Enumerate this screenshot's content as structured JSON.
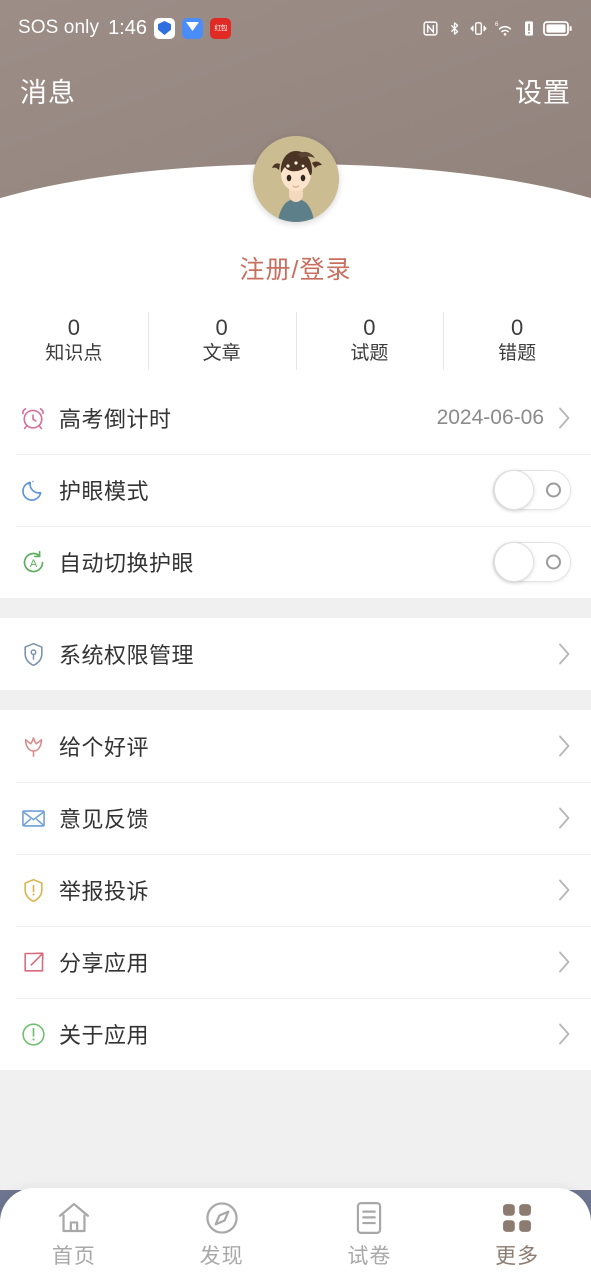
{
  "statusbar": {
    "carrier": "SOS only",
    "time": "1:46",
    "app_icons": [
      "shield-app-icon",
      "messenger-app-icon",
      "red-app-icon"
    ],
    "red_icon_text": "红包",
    "right_icons": [
      "nfc-icon",
      "bluetooth-icon",
      "vibrate-icon",
      "wifi6-icon",
      "signal-alert-icon",
      "battery-icon"
    ]
  },
  "header": {
    "left_title": "消息",
    "right_title": "设置",
    "background_color": "#968881"
  },
  "profile": {
    "avatar_name": "user-avatar",
    "login_text": "注册/登录",
    "login_color": "#c8705f"
  },
  "stats": [
    {
      "value": "0",
      "label": "知识点"
    },
    {
      "value": "0",
      "label": "文章"
    },
    {
      "value": "0",
      "label": "试题"
    },
    {
      "value": "0",
      "label": "错题"
    }
  ],
  "sections": [
    {
      "rows": [
        {
          "icon": "alarm-clock-icon",
          "icon_color": "#d3719f",
          "label": "高考倒计时",
          "value": "2024-06-06",
          "control": "chevron"
        },
        {
          "icon": "moon-icon",
          "icon_color": "#5b93d6",
          "label": "护眼模式",
          "value": "",
          "control": "toggle",
          "toggle_on": false
        },
        {
          "icon": "auto-switch-icon",
          "icon_color": "#5fae5f",
          "label": "自动切换护眼",
          "value": "",
          "control": "toggle",
          "toggle_on": false
        }
      ]
    },
    {
      "rows": [
        {
          "icon": "shield-key-icon",
          "icon_color": "#7a93ad",
          "label": "系统权限管理",
          "value": "",
          "control": "chevron"
        }
      ]
    },
    {
      "rows": [
        {
          "icon": "tulip-icon",
          "icon_color": "#d98c8c",
          "label": "给个好评",
          "value": "",
          "control": "chevron"
        },
        {
          "icon": "envelope-icon",
          "icon_color": "#6f9fd8",
          "label": "意见反馈",
          "value": "",
          "control": "chevron"
        },
        {
          "icon": "report-shield-icon",
          "icon_color": "#d8b44a",
          "label": "举报投诉",
          "value": "",
          "control": "chevron"
        },
        {
          "icon": "share-icon",
          "icon_color": "#d9697c",
          "label": "分享应用",
          "value": "",
          "control": "chevron"
        },
        {
          "icon": "info-circle-icon",
          "icon_color": "#6fbf6f",
          "label": "关于应用",
          "value": "",
          "control": "chevron"
        }
      ]
    }
  ],
  "tabbar": {
    "active_color": "#8b7b71",
    "inactive_color": "#a8a8a8",
    "tabs": [
      {
        "icon": "home-icon",
        "label": "首页",
        "active": false
      },
      {
        "icon": "compass-icon",
        "label": "发现",
        "active": false
      },
      {
        "icon": "paper-icon",
        "label": "试卷",
        "active": false
      },
      {
        "icon": "grid-icon",
        "label": "更多",
        "active": true
      }
    ]
  }
}
